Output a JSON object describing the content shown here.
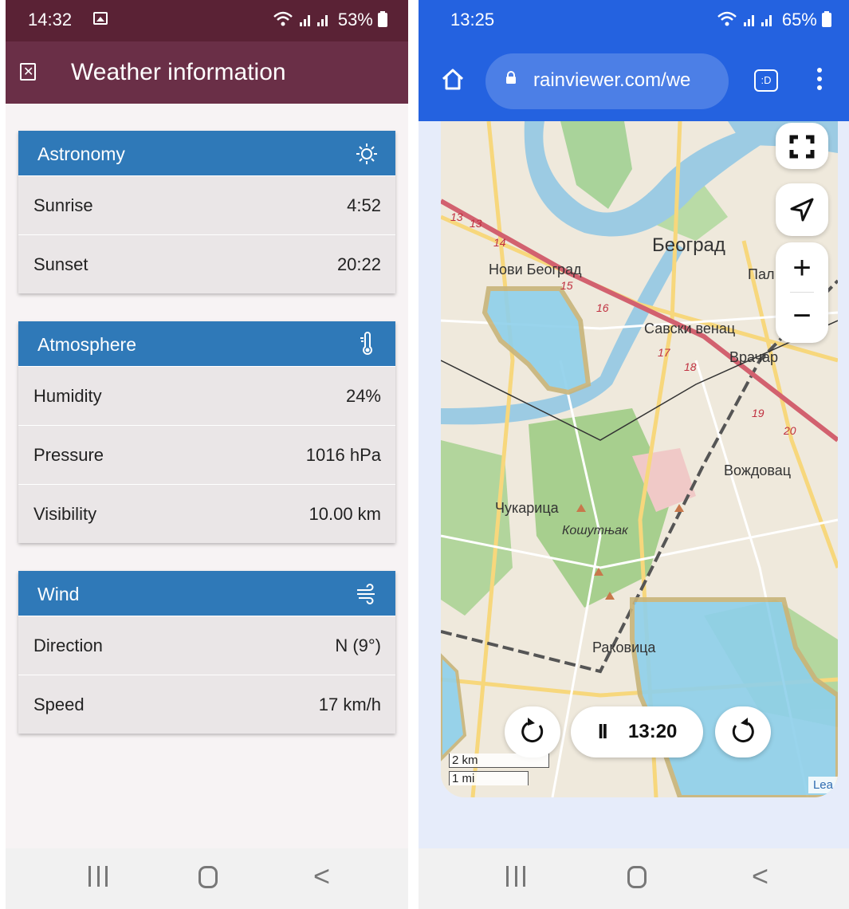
{
  "left": {
    "status": {
      "time": "14:32",
      "right": "53%"
    },
    "header": {
      "title": "Weather information"
    },
    "cards": {
      "astronomy": {
        "title": "Astronomy",
        "rows": [
          {
            "k": "Sunrise",
            "v": "4:52"
          },
          {
            "k": "Sunset",
            "v": "20:22"
          }
        ]
      },
      "atmosphere": {
        "title": "Atmosphere",
        "rows": [
          {
            "k": "Humidity",
            "v": "24%"
          },
          {
            "k": "Pressure",
            "v": "1016 hPa"
          },
          {
            "k": "Visibility",
            "v": "10.00 km"
          }
        ]
      },
      "wind": {
        "title": "Wind",
        "rows": [
          {
            "k": "Direction",
            "v": "N (9°)"
          },
          {
            "k": "Speed",
            "v": "17 km/h"
          }
        ]
      }
    },
    "nav": {
      "back": "<"
    }
  },
  "right": {
    "status": {
      "time": "13:25",
      "right": "65%"
    },
    "browser": {
      "url": "rainviewer.com/we",
      "tab_badge": ":D"
    },
    "map": {
      "labels": {
        "beograd": "Београд",
        "novi_beograd": "Нови Београд",
        "savski_venac": "Савски венац",
        "vracar": "Врачар",
        "pal": "Пал",
        "vozdovac": "Вождовац",
        "cukarica": "Чукарица",
        "kosutnjak": "Кошутњак",
        "rakovica": "Раковица"
      },
      "route_numbers": [
        "13",
        "13",
        "14",
        "15",
        "16",
        "17",
        "18",
        "19",
        "20"
      ],
      "controls": {
        "zoom_in": "+",
        "zoom_out": "−"
      },
      "player": {
        "time": "13:20",
        "pause": "II"
      },
      "scale": {
        "km": "2 km",
        "mi": "1 mi"
      },
      "attribution": "Lea"
    },
    "nav": {
      "back": "<"
    }
  }
}
